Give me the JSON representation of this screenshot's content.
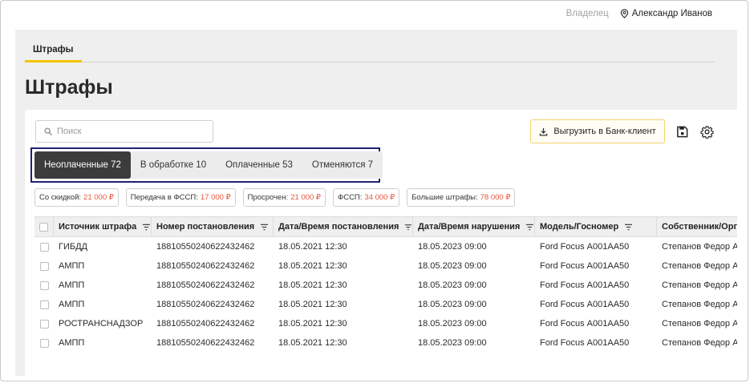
{
  "header": {
    "role_label": "Владелец",
    "user_name": "Александр Иванов"
  },
  "nav": {
    "tabs": [
      {
        "label": "Штрафы",
        "active": true
      }
    ]
  },
  "page": {
    "title": "Штрафы"
  },
  "toolbar": {
    "search_placeholder": "Поиск",
    "export_label": "Выгрузить в Банк-клиент",
    "accent": "#f2c500"
  },
  "status_tabs": [
    {
      "label": "Неоплаченные 72",
      "active": true
    },
    {
      "label": "В обработке 10",
      "active": false
    },
    {
      "label": "Оплаченные 53",
      "active": false
    },
    {
      "label": "Отменяются 7",
      "active": false
    }
  ],
  "chips": [
    {
      "label": "Со скидкой:",
      "amount": "21 000 ₽"
    },
    {
      "label": "Передача в ФССП:",
      "amount": "17 000 ₽"
    },
    {
      "label": "Просрочен:",
      "amount": "21 000 ₽"
    },
    {
      "label": "ФССП:",
      "amount": "34 000 ₽"
    },
    {
      "label": "Большие штрафы:",
      "amount": "78 000 ₽"
    }
  ],
  "table": {
    "columns": [
      "Источник штрафа",
      "Номер постановления",
      "Дата/Время постановления",
      "Дата/Время нарушения",
      "Модель/Госномер",
      "Собственник/Органи"
    ],
    "rows": [
      [
        "ГИБДД",
        "18810550240622432462",
        "18.05.2021 12:30",
        "18.05.2023 09:00",
        "Ford Focus А001АА50",
        "Степанов Федор А."
      ],
      [
        "АМПП",
        "18810550240622432462",
        "18.05.2021 12:30",
        "18.05.2023 09:00",
        "Ford Focus А001АА50",
        "Степанов Федор А."
      ],
      [
        "АМПП",
        "18810550240622432462",
        "18.05.2021 12:30",
        "18.05.2023 09:00",
        "Ford Focus А001АА50",
        "Степанов Федор А."
      ],
      [
        "АМПП",
        "18810550240622432462",
        "18.05.2021 12:30",
        "18.05.2023 09:00",
        "Ford Focus А001АА50",
        "Степанов Федор А."
      ],
      [
        "РОСТРАНСНАДЗОР",
        "18810550240622432462",
        "18.05.2021 12:30",
        "18.05.2023 09:00",
        "Ford Focus А001АА50",
        "Степанов Федор А."
      ],
      [
        "АМПП",
        "18810550240622432462",
        "18.05.2021 12:30",
        "18.05.2023 09:00",
        "Ford Focus А001АА50",
        "Степанов Федор А."
      ]
    ]
  },
  "icons": {
    "user": "location-pin-icon",
    "search": "search-icon",
    "export": "download-icon",
    "save": "save-icon",
    "settings": "gear-icon",
    "filter": "filter-icon"
  }
}
